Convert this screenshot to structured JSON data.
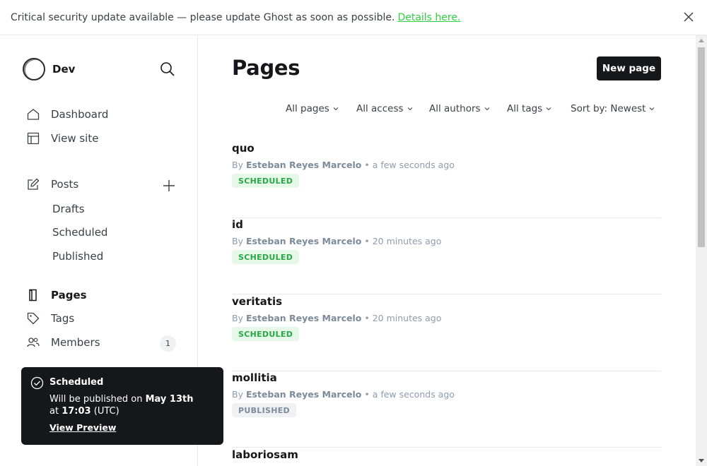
{
  "banner": {
    "message": "Critical security update available — please update Ghost as soon as possible.",
    "link_text": "Details here."
  },
  "sidebar": {
    "site_name": "Dev",
    "nav": {
      "dashboard": "Dashboard",
      "view_site": "View site",
      "posts": "Posts",
      "drafts": "Drafts",
      "scheduled": "Scheduled",
      "published": "Published",
      "pages": "Pages",
      "tags": "Tags",
      "members": "Members",
      "members_count": "1"
    }
  },
  "toast": {
    "title": "Scheduled",
    "msg_prefix": "Will be published on",
    "date": "May 13th",
    "at": "at",
    "time": "17:03",
    "tz": "(UTC)",
    "link": "View Preview"
  },
  "main": {
    "title": "Pages",
    "new_button": "New page",
    "filters": [
      "All pages",
      "All access",
      "All authors",
      "All tags",
      "Sort by: Newest"
    ],
    "rows": [
      {
        "title": "quo",
        "by": "By",
        "author": "Esteban Reyes Marcelo",
        "time": "• a few seconds ago",
        "status": "SCHEDULED"
      },
      {
        "title": "id",
        "by": "By",
        "author": "Esteban Reyes Marcelo",
        "time": "• 20 minutes ago",
        "status": "SCHEDULED"
      },
      {
        "title": "veritatis",
        "by": "By",
        "author": "Esteban Reyes Marcelo",
        "time": "• 20 minutes ago",
        "status": "SCHEDULED"
      },
      {
        "title": "mollitia",
        "by": "By",
        "author": "Esteban Reyes Marcelo",
        "time": "• a few seconds ago",
        "status": "PUBLISHED"
      },
      {
        "title": "laboriosam"
      }
    ]
  },
  "colors": {
    "accent_green": "#30cf43",
    "scheduled_text": "#28a745",
    "dark": "#15171a"
  }
}
